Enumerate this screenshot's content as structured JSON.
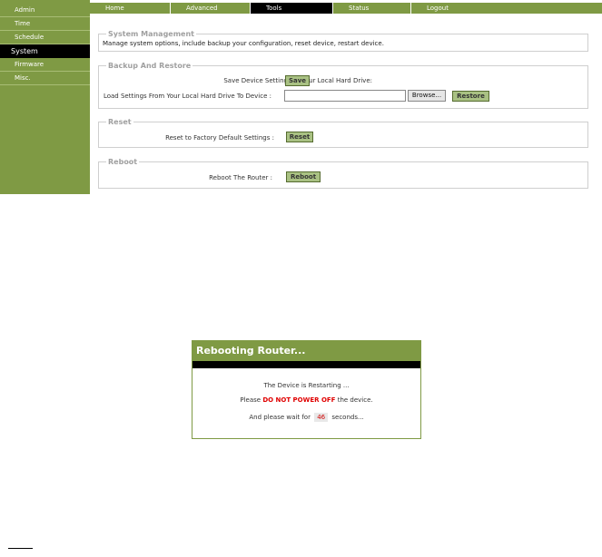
{
  "sidebar": {
    "items": [
      {
        "label": "Admin"
      },
      {
        "label": "Time"
      },
      {
        "label": "Schedule"
      },
      {
        "label": "System"
      },
      {
        "label": "Firmware"
      },
      {
        "label": "Misc."
      }
    ]
  },
  "nav": {
    "tabs": [
      {
        "label": "Home"
      },
      {
        "label": "Advanced"
      },
      {
        "label": "Tools"
      },
      {
        "label": "Status"
      },
      {
        "label": "Logout"
      }
    ]
  },
  "system_management": {
    "title": "System Management",
    "description": "Manage system options, include backup your configuration, reset device, restart device."
  },
  "backup_restore": {
    "title": "Backup And Restore",
    "save_label": "Save Device Settings To Your Local Hard Drive:",
    "save_button": "Save",
    "load_label": "Load Settings From Your Local Hard Drive To Device :",
    "file_value": "",
    "browse_button": "Browse...",
    "restore_button": "Restore"
  },
  "reset": {
    "title": "Reset",
    "label": "Reset to Factory Default Settings :",
    "button": "Reset"
  },
  "reboot": {
    "title": "Reboot",
    "label": "Reboot The Router :",
    "button": "Reboot"
  },
  "dialog": {
    "title": "Rebooting Router...",
    "line1": "The Device is Restarting ...",
    "line2_pre": "Please",
    "line2_warn": "DO NOT POWER OFF",
    "line2_post": "the device.",
    "line3_pre": "And please wait for",
    "countdown": "46",
    "line3_post": "seconds..."
  },
  "colors": {
    "accent_green": "#7f9a44",
    "button_green": "#a9c183",
    "warning_red": "#e00000"
  }
}
